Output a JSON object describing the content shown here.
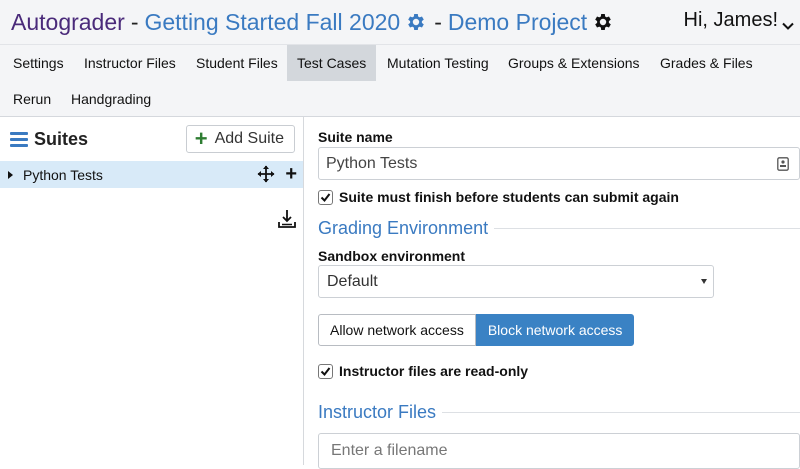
{
  "header": {
    "app_name": "Autograder",
    "separator": "-",
    "course": "Getting Started Fall 2020",
    "project": "Demo Project",
    "greeting": "Hi, James!"
  },
  "tabs": [
    {
      "label": "Settings",
      "active": false
    },
    {
      "label": "Instructor Files",
      "active": false
    },
    {
      "label": "Student Files",
      "active": false
    },
    {
      "label": "Test Cases",
      "active": true
    },
    {
      "label": "Mutation Testing",
      "active": false
    },
    {
      "label": "Groups & Extensions",
      "active": false
    },
    {
      "label": "Grades & Files",
      "active": false
    },
    {
      "label": "Rerun",
      "active": false
    },
    {
      "label": "Handgrading",
      "active": false
    }
  ],
  "sidebar": {
    "title": "Suites",
    "add_button": "Add Suite",
    "suites": [
      {
        "name": "Python Tests",
        "selected": true
      }
    ]
  },
  "form": {
    "suite_name_label": "Suite name",
    "suite_name_value": "Python Tests",
    "deferred_label": "Suite must finish before students can submit again",
    "deferred_checked": true,
    "grading_env_title": "Grading Environment",
    "sandbox_label": "Sandbox environment",
    "sandbox_value": "Default",
    "allow_network": "Allow network access",
    "block_network": "Block network access",
    "network_selected": "block",
    "readonly_label": "Instructor files are read-only",
    "readonly_checked": true,
    "instructor_files_title": "Instructor Files",
    "filename_placeholder": "Enter a filename"
  },
  "colors": {
    "brand_purple": "#4a2a7a",
    "link_blue": "#3a7ac1",
    "selected_row": "#d8eaf8",
    "active_toggle": "#3a82c4",
    "add_green": "#2e7d32"
  }
}
